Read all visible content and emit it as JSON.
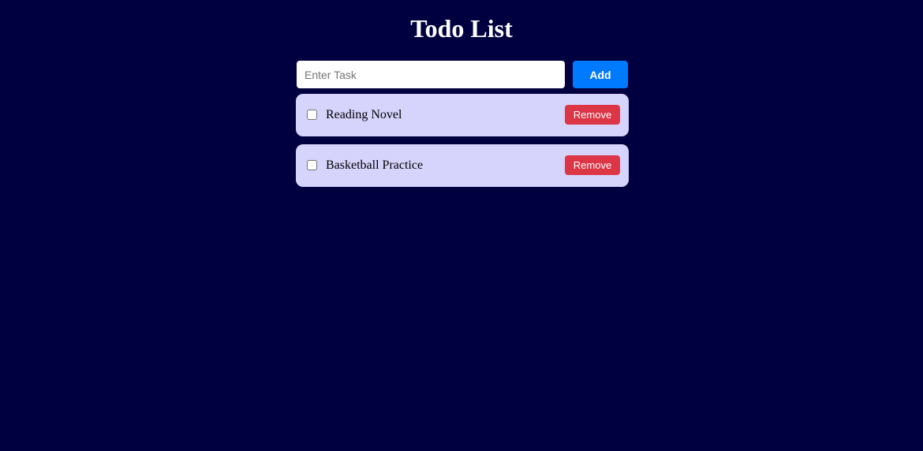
{
  "page": {
    "title": "Todo List"
  },
  "form": {
    "input_value": "",
    "input_placeholder": "Enter Task",
    "add_label": "Add"
  },
  "tasks": [
    {
      "label": "Reading Novel",
      "checked": false,
      "remove_label": "Remove"
    },
    {
      "label": "Basketball Practice",
      "checked": false,
      "remove_label": "Remove"
    }
  ],
  "colors": {
    "background": "#000040",
    "title_text": "#ffffff",
    "add_button": "#007bff",
    "remove_button": "#dc3545",
    "task_card": "#d6d3fc"
  }
}
